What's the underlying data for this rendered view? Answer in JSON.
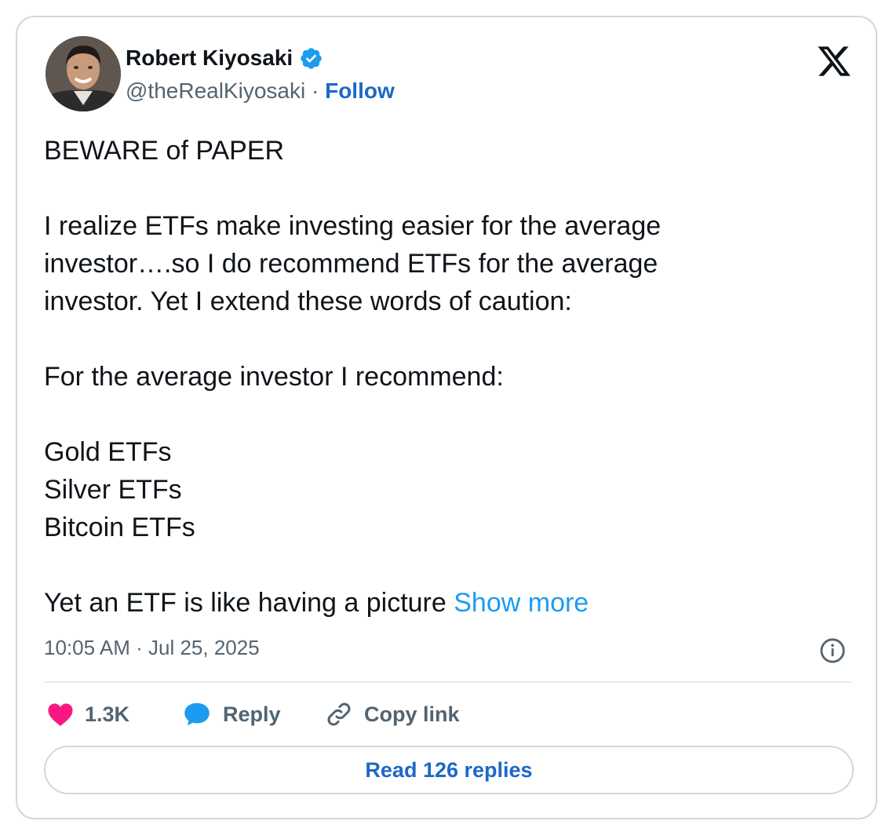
{
  "author": {
    "name": "Robert Kiyosaki",
    "handle": "@theRealKiyosaki",
    "separator": "·",
    "follow_label": "Follow",
    "verified_color": "#1d9bf0"
  },
  "tweet": {
    "lines": [
      "BEWARE of PAPER",
      "",
      "I realize ETFs make investing easier for the average",
      "investor….so I do recommend ETFs for the average",
      "investor.  Yet I extend these words of caution:",
      "",
      "For the average investor I recommend:",
      "",
      "Gold ETFs",
      "Silver ETFs",
      "Bitcoin ETFs",
      ""
    ],
    "last_line": "Yet an ETF is like having a picture",
    "show_more_label": "Show more"
  },
  "timestamp": {
    "time": "10:05 AM",
    "separator": "·",
    "date": "Jul 25, 2025"
  },
  "actions": {
    "like_count": "1.3K",
    "reply_label": "Reply",
    "copy_link_label": "Copy link"
  },
  "read_replies_label": "Read 126 replies",
  "icons": {
    "logo": "x-logo-icon",
    "verified": "verified-badge-icon",
    "info": "info-icon",
    "like": "heart-icon",
    "reply": "speech-bubble-icon",
    "copy_link": "link-icon"
  },
  "colors": {
    "heart": "#f91880",
    "reply_bubble": "#1d9bf0",
    "link_blue": "#1d68c7",
    "show_more": "#1d9bf0"
  }
}
